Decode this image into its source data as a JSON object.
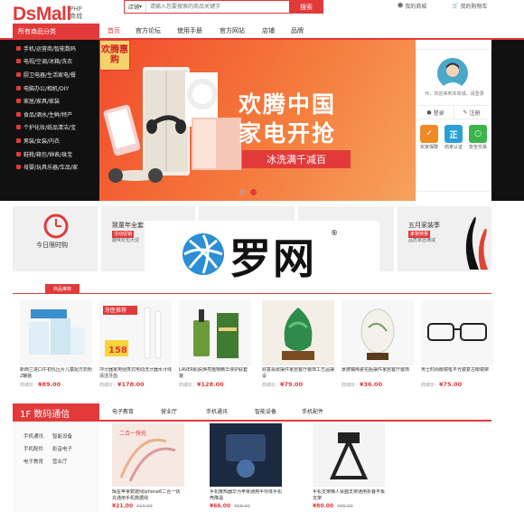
{
  "header": {
    "logo": "DsMall",
    "logo_sub_top": "PHP",
    "logo_sub_bottom": "商城",
    "search_scope": "店铺",
    "search_placeholder": "请输入您要搜索的商品关键字",
    "search_button": "搜索",
    "my_mall": "我的商城",
    "cart": "我的购物车"
  },
  "nav": {
    "category_title": "所有商品分类",
    "items": [
      "首页",
      "官方论坛",
      "使用手册",
      "官方网站",
      "店铺",
      "品牌"
    ]
  },
  "categories": [
    "手机/运营商/智能数码",
    "电视/空调/冰箱/洗衣",
    "厨卫电器/生活家电/餐",
    "电脑办公/相机/DIY",
    "家居/家具/家装",
    "食品/酒水/生鲜/特产",
    "个护化妆/纸品清洁/宝",
    "男装/女装/内衣",
    "鞋靴/箱包/钟表/珠宝",
    "母婴/玩具乐器/车品/家"
  ],
  "banner": {
    "badge": "欢腾惠购",
    "title_line1": "欢腾中国",
    "title_line2": "家电开抢",
    "promo": "冰洗满千减百"
  },
  "user_panel": {
    "welcome": "Hi，欢迎来到本商城，请登录",
    "login": "登录",
    "register": "注册",
    "services": [
      "买家保障",
      "商家认证",
      "安全交易"
    ]
  },
  "promo_row": {
    "tile1_label": "今日限时购",
    "tile2_title": "致童年全套",
    "tile2_tag": "活动促销",
    "tile2_sub": "趣味玩包大促",
    "tile5_title": "五月家装季",
    "tile5_tag": "家装特惠",
    "tile5_sub": "品质家居满减"
  },
  "watermark": {
    "text": "罗网",
    "mark": "®"
  },
  "recommend": {
    "tab": "商品推荐",
    "products": [
      {
        "name": "新西兰进口牛初乳压片儿童配方奶粉2罐装",
        "price_prefix": "商城价：",
        "price": "¥89.00",
        "image_text": ""
      },
      {
        "name": "冲牙器家用便携式电动洗牙器水牙线清洁牙齿",
        "price_prefix": "商城价：",
        "price": "¥178.00",
        "image_text": "牙医推荐"
      },
      {
        "name": "LAVER肌肤焕亮植物精华液护肤套装",
        "price_prefix": "商城价：",
        "price": "¥128.00",
        "image_text": ""
      },
      {
        "name": "财富翡翠摆件家居客厅装饰工艺品摆设",
        "price_prefix": "商城价：",
        "price": "¥79.00",
        "image_text": ""
      },
      {
        "name": "景德镇陶瓷花瓶摆件家居客厅装饰",
        "price_prefix": "商城价：",
        "price": "¥36.00",
        "image_text": ""
      },
      {
        "name": "男士时尚眼镜框平光镜复古眼镜架",
        "price_prefix": "商城价：",
        "price": "¥75.00",
        "image_text": ""
      }
    ]
  },
  "floor": {
    "title": "1F 数码通信",
    "tabs": [
      "电子教育",
      "营业厅",
      "手机通讯",
      "智能设备",
      "手机配件"
    ],
    "side_links": [
      "手机通讯",
      "智能设备",
      "手机配件",
      "影音电子",
      "电子教育",
      "营业厅"
    ],
    "products": [
      {
        "name": "辉星苹果数据线iphone6二合一快充通用手机数据线",
        "price": "¥21.00",
        "old_price": "¥19.00",
        "image_text": "二合一快充"
      },
      {
        "name": "手机散热器华为苹果通用半导体手机壳降温",
        "price": "¥66.00",
        "old_price": "¥58.00",
        "image_text": ""
      },
      {
        "name": "手机支架懒人桌面支架通用折叠平板支架",
        "price": "¥80.00",
        "old_price": "¥55.00",
        "image_text": ""
      }
    ]
  },
  "colors": {
    "accent": "#e23a3a",
    "banner_bg": "#f4723a",
    "sidebar_bg": "#111111"
  }
}
